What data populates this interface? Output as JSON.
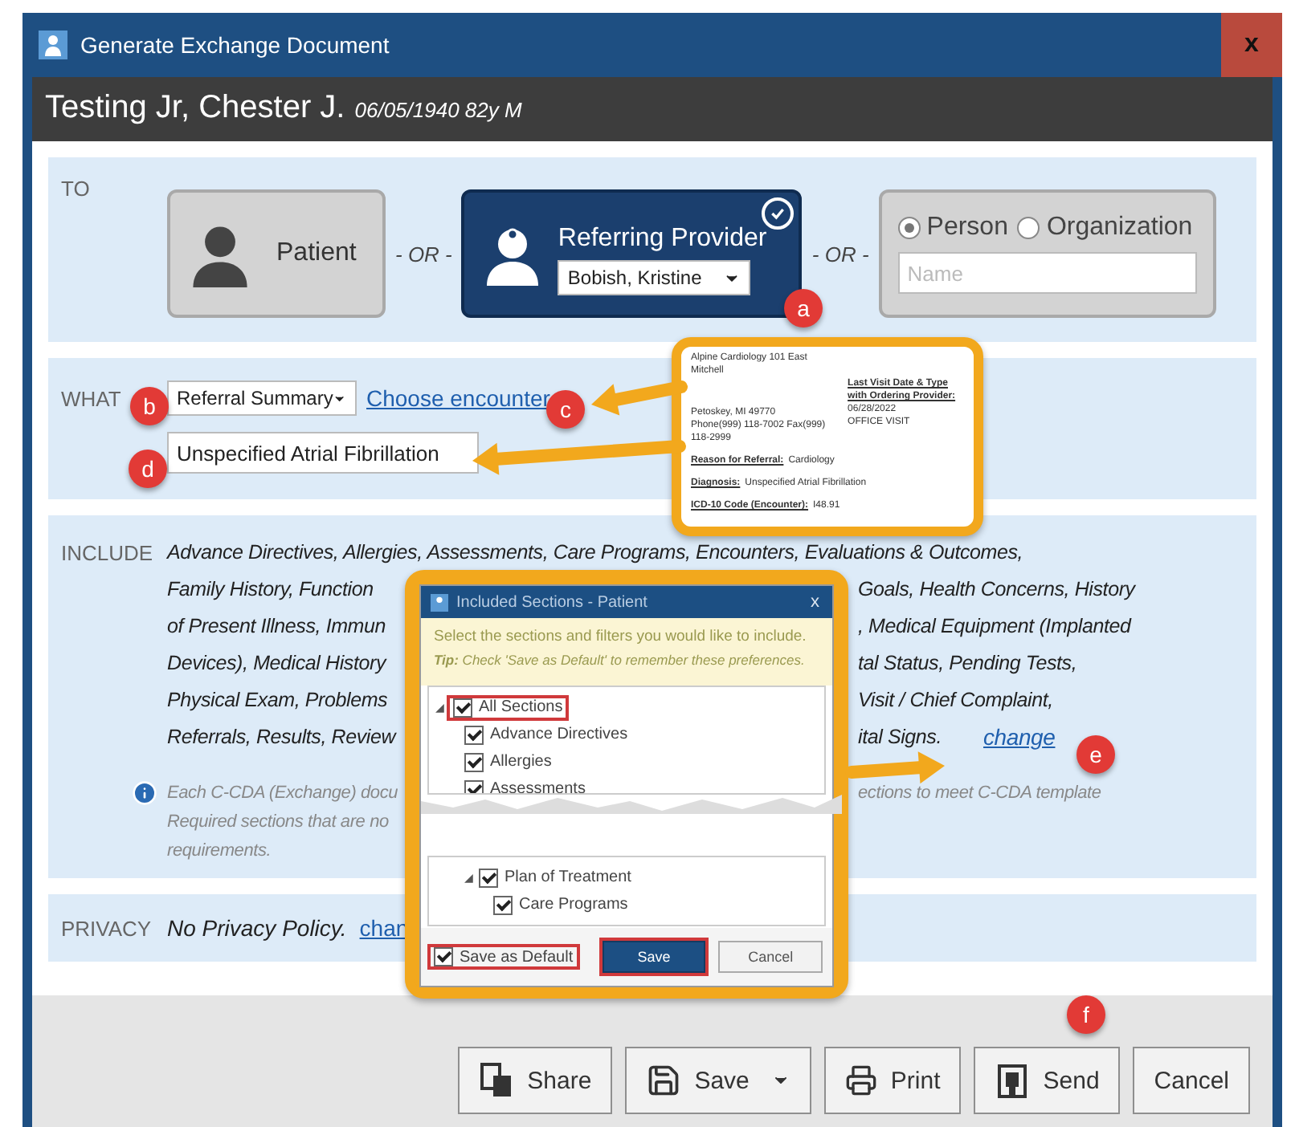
{
  "window": {
    "title": "Generate Exchange Document",
    "close": "x"
  },
  "patient": {
    "name": "Testing Jr, Chester J.",
    "details": "06/05/1940 82y M"
  },
  "to": {
    "label": "TO",
    "separators": [
      "- OR -",
      "- OR -"
    ],
    "options": [
      {
        "kind": "patient",
        "label": "Patient",
        "selected": false
      },
      {
        "kind": "provider",
        "label": "Referring Provider",
        "value": "Bobish, Kristine",
        "selected": true
      },
      {
        "kind": "other",
        "radios": [
          {
            "label": "Person",
            "selected": true
          },
          {
            "label": "Organization",
            "selected": false
          }
        ],
        "placeholder": "Name",
        "selected": false
      }
    ]
  },
  "what": {
    "label": "WHAT",
    "document_type": "Referral Summary",
    "link": "Choose encounter",
    "diagnosis": "Unspecified Atrial Fibrillation"
  },
  "include": {
    "label": "INCLUDE",
    "first_line": "Advance Directives, Allergies, Assessments, Care Programs, Encounters, Evaluations & Outcomes,",
    "lines": [
      {
        "left": "Family History, Function",
        "right": "Goals, Health Concerns, History"
      },
      {
        "left": "of Present Illness, Immun",
        "right": ", Medical Equipment (Implanted"
      },
      {
        "left": "Devices), Medical History",
        "right": "tal Status, Pending Tests,"
      },
      {
        "left": "Physical Exam, Problems",
        "right": "Visit / Chief Complaint,"
      },
      {
        "left": "Referrals, Results, Review",
        "right": "ital Signs."
      }
    ],
    "change": "change",
    "note_lines": [
      {
        "left": "Each C-CDA (Exchange) docu",
        "right": "ections to meet C-CDA template"
      },
      {
        "left": "Required sections that are no"
      },
      {
        "left": "requirements."
      }
    ]
  },
  "privacy": {
    "label": "PRIVACY",
    "text": "No Privacy Policy.",
    "link": "chan"
  },
  "buttons": [
    {
      "kind": "share",
      "label": "Share"
    },
    {
      "kind": "save",
      "label": "Save"
    },
    {
      "kind": "print",
      "label": "Print"
    },
    {
      "kind": "send",
      "label": "Send"
    },
    {
      "kind": "cancel",
      "label": "Cancel"
    }
  ],
  "badges": [
    "a",
    "b",
    "c",
    "d",
    "e",
    "f"
  ],
  "preview": {
    "address": [
      "Alpine Cardiology 101 East Mitchell",
      "Petoskey, MI 49770",
      "Phone(999) 118-7002  Fax(999) 118-2999"
    ],
    "heading": "Last Visit Date & Type with Ordering Provider:",
    "visit": [
      "06/28/2022",
      "OFFICE VISIT"
    ],
    "fields": [
      {
        "label": "Reason for Referral:",
        "value": "Cardiology"
      },
      {
        "label": "Diagnosis:",
        "value": "Unspecified Atrial Fibrillation"
      },
      {
        "label": "ICD-10 Code (Encounter):",
        "value": "I48.91"
      }
    ]
  },
  "sections_dialog": {
    "title": "Included Sections - Patient",
    "close": "x",
    "intro": "Select the sections and filters you would like to include.",
    "tip": "**Tip:** Check 'Save as Default' to remember these preferences.",
    "tree_top": [
      {
        "label": "All Sections",
        "checked": true,
        "highlighted": true,
        "expander": "◢",
        "children": [
          {
            "label": "Advance Directives",
            "checked": true,
            "highlighted": false
          },
          {
            "label": "Allergies",
            "checked": true,
            "highlighted": false
          },
          {
            "label": "Assessments",
            "checked": true,
            "highlighted": false
          }
        ]
      }
    ],
    "tree_bottom": [
      {
        "label": "Plan of Treatment",
        "checked": true,
        "highlighted": false,
        "expander": "◢",
        "children": [
          {
            "label": "Care Programs",
            "checked": true,
            "highlighted": false
          }
        ]
      }
    ],
    "save_default": {
      "label": "Save as Default",
      "checked": true,
      "highlighted": true
    },
    "buttons": [
      {
        "label": "Save",
        "primary": true,
        "highlighted": true
      },
      {
        "label": "Cancel",
        "primary": false,
        "highlighted": false
      }
    ]
  }
}
